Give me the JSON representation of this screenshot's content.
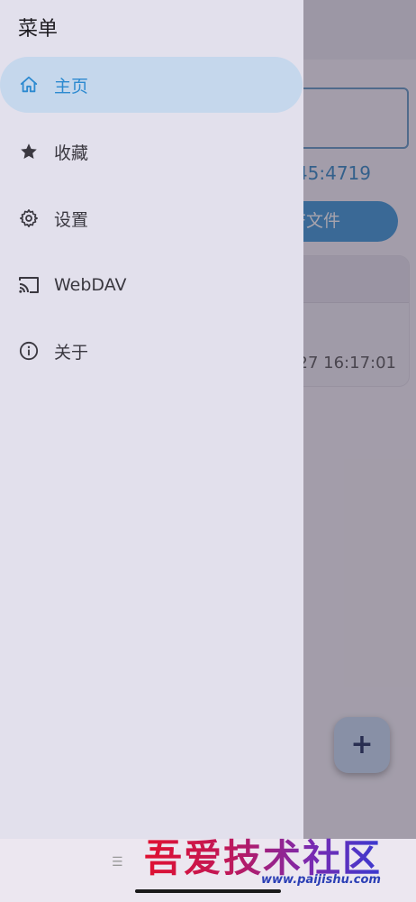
{
  "drawer": {
    "title": "菜单",
    "items": [
      {
        "label": "主页",
        "icon": "home-icon",
        "active": true
      },
      {
        "label": "收藏",
        "icon": "star-icon",
        "active": false
      },
      {
        "label": "设置",
        "icon": "gear-icon",
        "active": false
      },
      {
        "label": "WebDAV",
        "icon": "cast-icon",
        "active": false
      },
      {
        "label": "关于",
        "icon": "info-icon",
        "active": false
      }
    ]
  },
  "background": {
    "address_partial": "45:4719",
    "open_button_partial": "F文件",
    "timestamp_partial": "–27 16:17:01",
    "fab_label": "+"
  },
  "watermark": {
    "text": "吾爱技术社区",
    "url": "www.paijishu.com"
  },
  "colors": {
    "accent": "#2d8ad0",
    "active_item_bg": "#c5d7ec",
    "drawer_bg": "#e2e0ec"
  }
}
